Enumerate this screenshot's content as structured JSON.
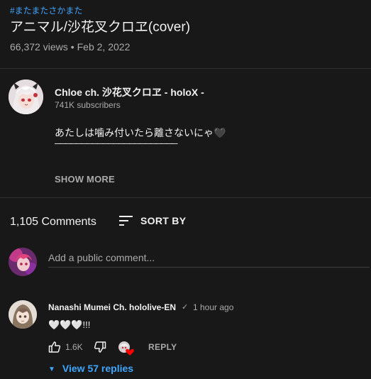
{
  "video": {
    "hashtag": "#またまたさかまた",
    "title": "アニマル/沙花叉クロヱ(cover)",
    "views": "66,372 views",
    "separator": "•",
    "date": "Feb 2, 2022"
  },
  "channel": {
    "name": "Chloe ch. 沙花叉クロヱ - holoX -",
    "subscribers": "741K subscribers",
    "avatar_icon": "channel-avatar-icon"
  },
  "description": {
    "line1": "あたしは噛み付いたら離さないにゃ🖤",
    "line2": "───────────────────────",
    "show_more": "SHOW MORE"
  },
  "comments_header": {
    "count": "1,105 Comments",
    "sort_label": "SORT BY",
    "sort_icon": "sort-icon"
  },
  "add_comment": {
    "placeholder": "Add a public comment..."
  },
  "comments": [
    {
      "author": "Nanashi Mumei Ch. hololive-EN",
      "verified": "✓",
      "time": "1 hour ago",
      "text": "🤍🤍🤍!!!",
      "likes": "1.6K",
      "reply_label": "REPLY",
      "view_replies": "View 57 replies"
    }
  ],
  "colors": {
    "background": "#181818",
    "text": "#f1f1f1",
    "secondary": "#aaaaaa",
    "link": "#3ea6ff",
    "divider": "#303030",
    "heart": "#ff0000"
  }
}
